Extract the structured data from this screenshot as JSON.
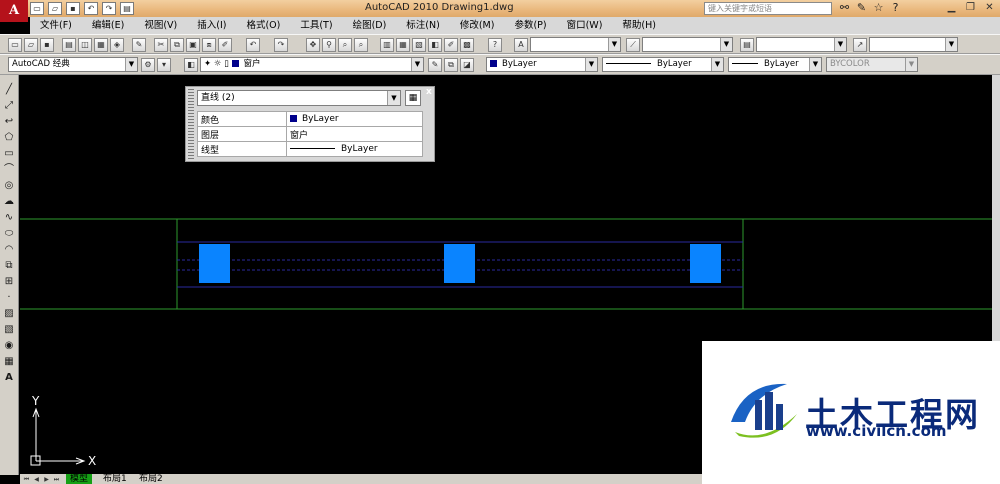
{
  "title_bar": {
    "app_logo": "A",
    "window_title": "AutoCAD 2010    Drawing1.dwg",
    "help_search_placeholder": "键入关键字或短语",
    "help_icons": [
      "binoculars-icon",
      "tools-icon",
      "star-icon",
      "help-icon"
    ],
    "window_controls": [
      "minimize",
      "restore",
      "close"
    ]
  },
  "menu": [
    "文件(F)",
    "编辑(E)",
    "视图(V)",
    "插入(I)",
    "格式(O)",
    "工具(T)",
    "绘图(D)",
    "标注(N)",
    "修改(M)",
    "参数(P)",
    "窗口(W)",
    "帮助(H)"
  ],
  "toolbar": {
    "workspace": "AutoCAD 经典",
    "layer": "窗户",
    "color": "ByLayer",
    "linetype": "ByLayer",
    "lineweight": "ByLayer",
    "plotstyle": "BYCOLOR"
  },
  "properties_panel": {
    "selection": "直线 (2)",
    "rows": [
      {
        "key": "颜色",
        "value": "ByLayer"
      },
      {
        "key": "图层",
        "value": "窗户"
      },
      {
        "key": "线型",
        "value": "ByLayer"
      }
    ],
    "close": "x"
  },
  "ucs": {
    "x_label": "X",
    "y_label": "Y"
  },
  "layout_tabs": [
    "模型",
    "布局1",
    "布局2"
  ],
  "watermark": {
    "logo_text": "土木工程网",
    "url": "www.civilcn.com"
  },
  "colors": {
    "canvas": "#000000",
    "wall_lines": "#2e9a2e",
    "window_lines": "#2a2a9e",
    "window_blocks": "#0a84ff",
    "ui_gray": "#d4d0c8"
  }
}
